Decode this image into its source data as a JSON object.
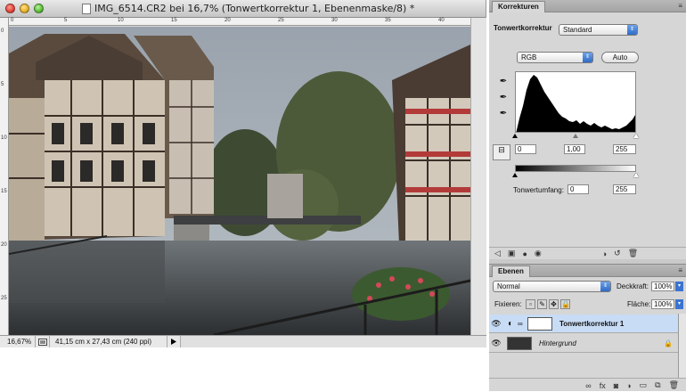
{
  "document": {
    "title": "IMG_6514.CR2 bei 16,7% (Tonwertkorrektur 1, Ebenenmaske/8) *",
    "ruler_top_ticks": [
      "0",
      "5",
      "10",
      "15",
      "20",
      "25",
      "30",
      "35",
      "40"
    ],
    "ruler_left_ticks": [
      "0",
      "5",
      "10",
      "15",
      "20",
      "25"
    ],
    "status_zoom": "16,67%",
    "status_info": "41,15 cm x 27,43 cm (240 ppi)"
  },
  "adjustments": {
    "tab_label": "Korrekturen",
    "panel_title": "Tonwertkorrektur",
    "preset_value": "Standard",
    "channel_value": "RGB",
    "auto_label": "Auto",
    "input_black": "0",
    "input_gamma": "1,00",
    "input_white": "255",
    "output_label": "Tonwertumfang:",
    "output_black": "0",
    "output_white": "255",
    "histogram_color": "#000000"
  },
  "layers": {
    "tab_label": "Ebenen",
    "blend_mode": "Normal",
    "opacity_label": "Deckkraft:",
    "opacity_value": "100%",
    "lock_label": "Fixieren:",
    "fill_label": "Fläche:",
    "fill_value": "100%",
    "items": [
      {
        "name": "Tonwertkorrektur 1",
        "selected": true
      },
      {
        "name": "Hintergrund",
        "selected": false
      }
    ],
    "selected_color": "#c8dcf5"
  }
}
